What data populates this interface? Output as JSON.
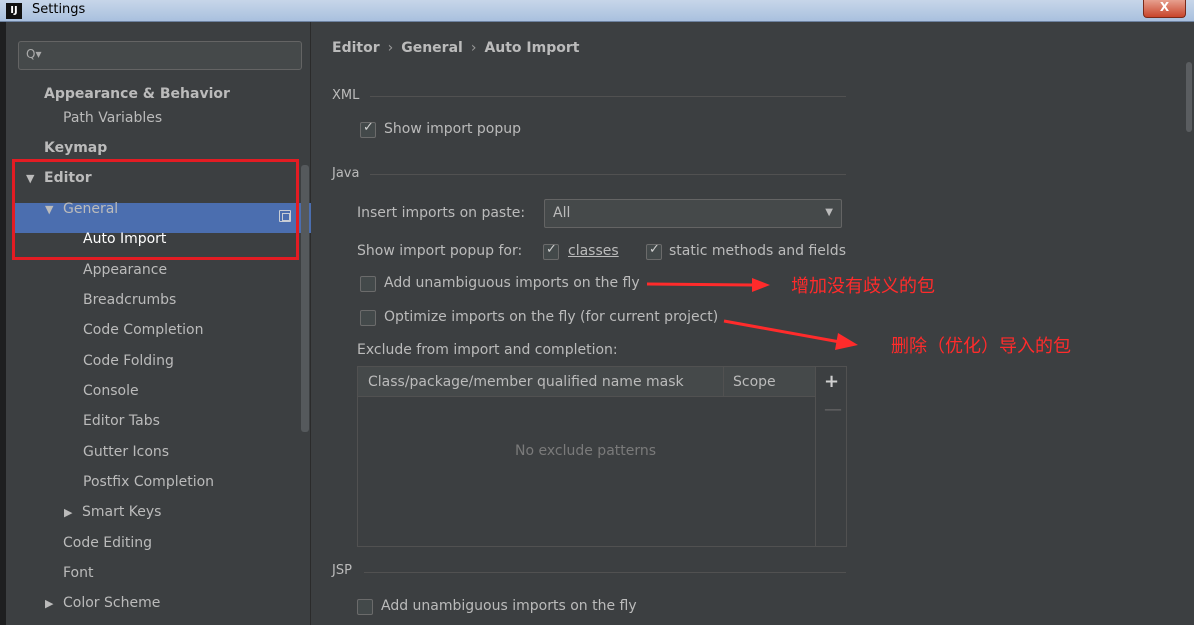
{
  "window": {
    "app_icon": "IJ",
    "title": "Settings",
    "close_glyph": "X"
  },
  "sidebar": {
    "search_icon": "Q▾",
    "items": [
      {
        "label": "Appearance & Behavior",
        "bold": true
      },
      {
        "label": "Path Variables"
      },
      {
        "label": "Keymap",
        "bold": true
      },
      {
        "label": "Editor",
        "bold": true,
        "arrow": "▼"
      },
      {
        "label": "General",
        "arrow": "▼"
      },
      {
        "label": "Auto Import",
        "selected": true
      },
      {
        "label": "Appearance"
      },
      {
        "label": "Breadcrumbs"
      },
      {
        "label": "Code Completion"
      },
      {
        "label": "Code Folding"
      },
      {
        "label": "Console"
      },
      {
        "label": "Editor Tabs"
      },
      {
        "label": "Gutter Icons"
      },
      {
        "label": "Postfix Completion"
      },
      {
        "label": "Smart Keys",
        "arrow": "▶"
      },
      {
        "label": "Code Editing"
      },
      {
        "label": "Font"
      },
      {
        "label": "Color Scheme",
        "arrow": "▶"
      }
    ]
  },
  "breadcrumb": {
    "items": [
      "Editor",
      "General",
      "Auto Import"
    ],
    "sep": "›"
  },
  "xml": {
    "section": "XML",
    "show_import_popup": {
      "label": "Show import popup",
      "checked": true
    }
  },
  "java": {
    "section": "Java",
    "insert_imports_label": "Insert imports on paste:",
    "insert_imports_value": "All",
    "dropdown_arrow": "▼",
    "show_popup_for_label": "Show import popup for:",
    "classes": {
      "label": "classes",
      "checked": true
    },
    "static_methods": {
      "label": "static methods and fields",
      "checked": true
    },
    "add_unambiguous": {
      "label": "Add unambiguous imports on the fly",
      "checked": false
    },
    "optimize_imports": {
      "label": "Optimize imports on the fly (for current project)",
      "checked": false
    },
    "exclude_label": "Exclude from import and completion:",
    "table": {
      "columns": [
        "Class/package/member qualified name mask",
        "Scope"
      ],
      "empty_text": "No exclude patterns",
      "add": "+",
      "remove": "—"
    }
  },
  "jsp": {
    "section": "JSP",
    "add_unambiguous": {
      "label": "Add unambiguous imports on the fly",
      "checked": false
    }
  },
  "annotations": {
    "first": "增加没有歧义的包",
    "second": "删除（优化）导入的包",
    "color": "#ff2b2b"
  }
}
